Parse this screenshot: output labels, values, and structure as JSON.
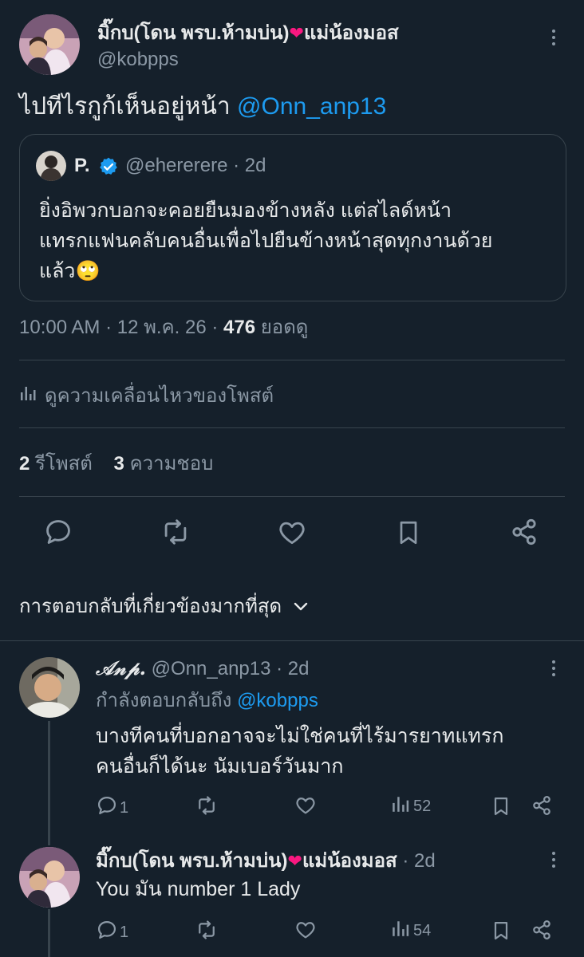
{
  "main_post": {
    "author_name": "มิ๊กบ(โดน พรบ.ห้ามบ่น)",
    "author_name_suffix": "แม่น้องมอส",
    "heart_emoji": "❤️",
    "handle": "@kobpps",
    "text": "ไปทีไรกูก้เห็นอยู่หน้า",
    "mention": "@Onn_anp13",
    "quote": {
      "name": "P.",
      "handle": "@ehererere",
      "time": "· 2d",
      "text_line1": "ยิ่งอิพวกบอกจะคอยยืนมองข้างหลัง แต่สไลด์หน้า",
      "text_line2": "แทรกแฟนคลับคนอื่นเพื่อไปยืนข้างหน้าสุดทุกงานด้วย",
      "text_line3": "แล้ว",
      "emoji": "🙄"
    },
    "timestamp": "10:00 AM · 12 พ.ค. 26 ·",
    "views_count": "476",
    "views_label": "ยอดดู",
    "engagement_link": "ดูความเคลื่อนไหวของโพสต์",
    "reposts_count": "2",
    "reposts_label": "รีโพสต์",
    "likes_count": "3",
    "likes_label": "ความชอบ",
    "actions": [
      "reply-icon",
      "repost-icon",
      "like-icon",
      "bookmark-icon",
      "share-icon"
    ]
  },
  "replies_sort": {
    "label": "การตอบกลับที่เกี่ยวข้องมากที่สุด",
    "icon": "chevron-down-icon"
  },
  "replies": [
    {
      "name": "𝒜𝓃𝓅.",
      "handle": "@Onn_anp13",
      "time": "· 2d",
      "replying_to_label": "กำลังตอบกลับถึง",
      "replying_to_handle": "@kobpps",
      "text_line1": "บางทีคนที่บอกอาจจะไม่ใช่คนที่ไร้มารยาทแทรก",
      "text_line2": "คนอื่นก็ได้นะ นัมเบอร์วันมาก",
      "reply_count": "1",
      "views": "52"
    },
    {
      "name": "มิ๊กบ(โดน พรบ.ห้ามบ่น)",
      "name_suffix": "แม่น้องมอส",
      "heart_emoji": "❤️",
      "time": "· 2d",
      "text": "You มัน number 1 Lady",
      "reply_count": "1",
      "views": "54"
    }
  ],
  "colors": {
    "background": "#15202b",
    "text": "#e7e9ea",
    "muted": "#8b98a5",
    "accent": "#1d9bf0",
    "divider": "#38444d",
    "heart": "#f91880"
  }
}
